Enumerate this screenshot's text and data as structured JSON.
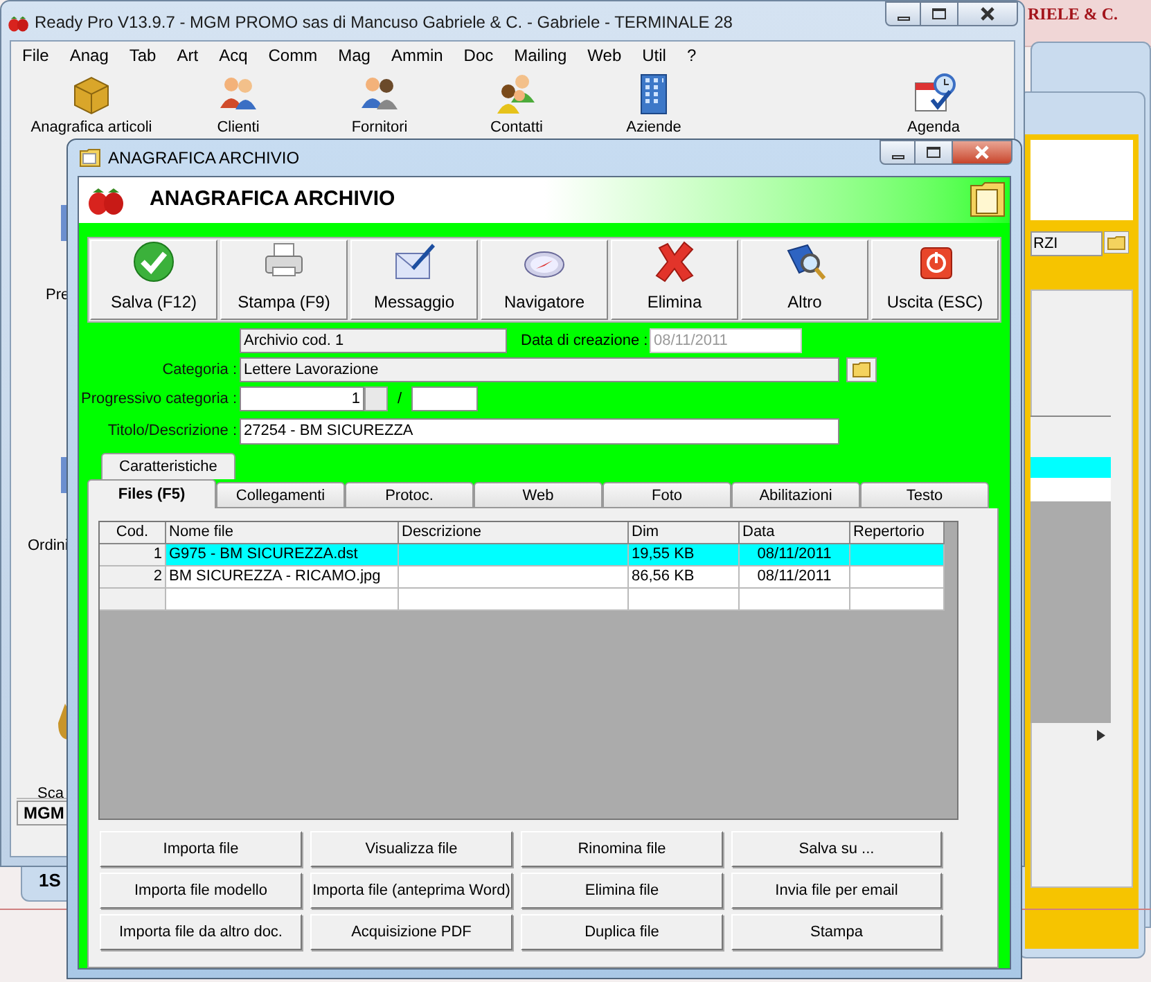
{
  "background": {
    "header_text": "RIELE & C.",
    "field_value": "RZI",
    "bottom_text": "1S"
  },
  "main_window": {
    "title": "Ready Pro V13.9.7 - MGM PROMO sas di Mancuso Gabriele & C. - Gabriele - TERMINALE 28",
    "menu": [
      "File",
      "Anag",
      "Tab",
      "Art",
      "Acq",
      "Comm",
      "Mag",
      "Ammin",
      "Doc",
      "Mailing",
      "Web",
      "Util",
      "?"
    ],
    "toolbar": [
      "Anagrafica articoli",
      "Clienti",
      "Fornitori",
      "Contatti",
      "Aziende",
      "Agenda"
    ],
    "side_labels": [
      "Pre",
      "Ordini",
      "Sca"
    ],
    "status_bar": "MGM"
  },
  "dialog": {
    "title": "ANAGRAFICA ARCHIVIO",
    "header": "ANAGRAFICA ARCHIVIO",
    "toolbar": [
      "Salva (F12)",
      "Stampa (F9)",
      "Messaggio",
      "Navigatore",
      "Elimina",
      "Altro",
      "Uscita (ESC)"
    ],
    "code_value": "Archivio cod. 1",
    "created_label": "Data di creazione :",
    "created_value": "08/11/2011",
    "category_label": "Categoria :",
    "category_value": "Lettere Lavorazione",
    "progressive_label": "Progressivo categoria :",
    "progressive_value": "1",
    "progressive_separator": "/",
    "title_label": "Titolo/Descrizione :",
    "title_value": "27254 - BM SICUREZZA",
    "outer_tabs": [
      {
        "label": "Caratteristiche",
        "selected": true
      }
    ],
    "tabs": [
      {
        "label": "Files (F5)",
        "selected": true
      },
      {
        "label": "Collegamenti",
        "selected": false
      },
      {
        "label": "Protoc.",
        "selected": false
      },
      {
        "label": "Web",
        "selected": false
      },
      {
        "label": "Foto",
        "selected": false
      },
      {
        "label": "Abilitazioni",
        "selected": false
      },
      {
        "label": "Testo",
        "selected": false
      }
    ],
    "table": {
      "columns": [
        "Cod.",
        "Nome file",
        "Descrizione",
        "Dim",
        "Data",
        "Repertorio"
      ],
      "rows": [
        {
          "cells": [
            "1",
            "G975 - BM SICUREZZA.dst",
            "",
            "19,55 KB",
            "08/11/2011",
            ""
          ],
          "selected": true
        },
        {
          "cells": [
            "2",
            "BM SICUREZZA - RICAMO.jpg",
            "",
            "86,56 KB",
            "08/11/2011",
            ""
          ],
          "selected": false
        }
      ]
    },
    "buttons": [
      "Importa file",
      "Visualizza file",
      "Rinomina file",
      "Salva su ...",
      "Importa file modello",
      "Importa file (anteprima Word)",
      "Elimina file",
      "Invia file per email",
      "Importa file da altro doc.",
      "Acquisizione PDF",
      "Duplica file",
      "Stampa"
    ]
  }
}
